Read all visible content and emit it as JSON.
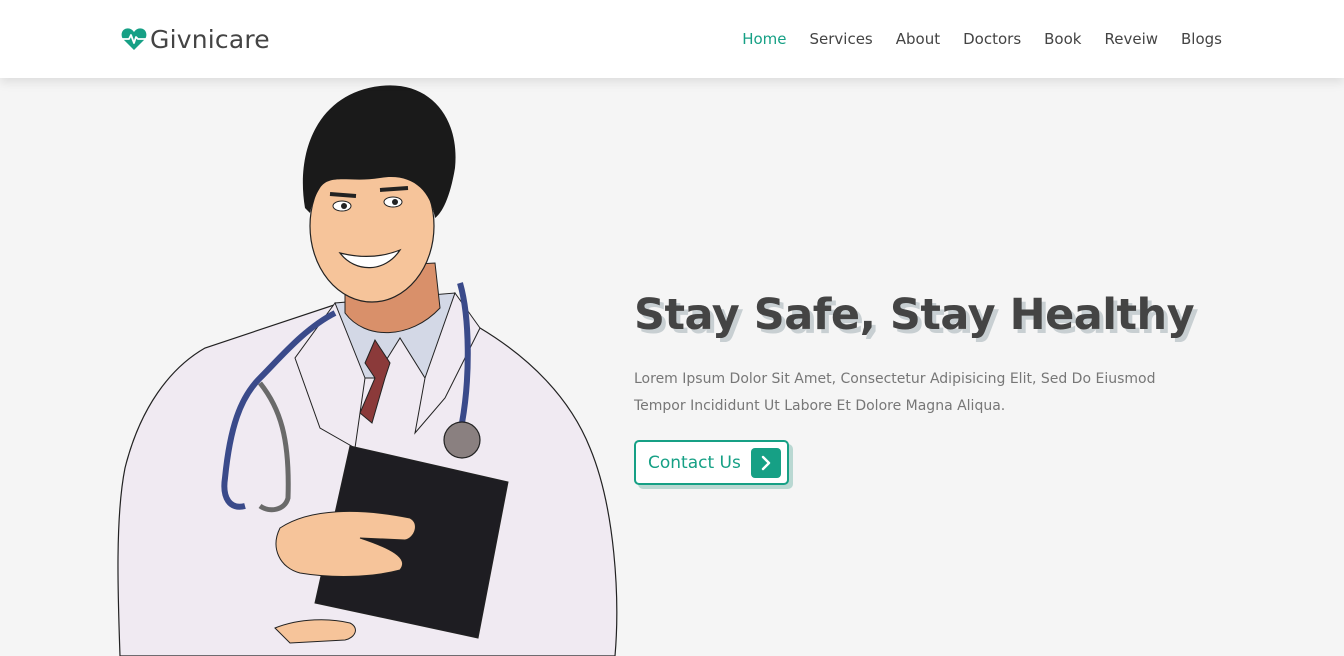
{
  "brand": {
    "name": "Givnicare",
    "accent": "#16a085",
    "text_color": "#444444"
  },
  "nav": {
    "items": [
      {
        "label": "Home",
        "active": true
      },
      {
        "label": "Services",
        "active": false
      },
      {
        "label": "About",
        "active": false
      },
      {
        "label": "Doctors",
        "active": false
      },
      {
        "label": "Book",
        "active": false
      },
      {
        "label": "Reveiw",
        "active": false
      },
      {
        "label": "Blogs",
        "active": false
      }
    ]
  },
  "hero": {
    "title": "Stay Safe, Stay Healthy",
    "text": "Lorem Ipsum Dolor Sit Amet, Consectetur Adipisicing Elit, Sed Do Eiusmod Tempor Incididunt Ut Labore Et Dolore Magna Aliqua.",
    "cta_label": "Contact Us",
    "cta_icon": "chevron-right-icon",
    "illustration": "doctor-illustration"
  }
}
